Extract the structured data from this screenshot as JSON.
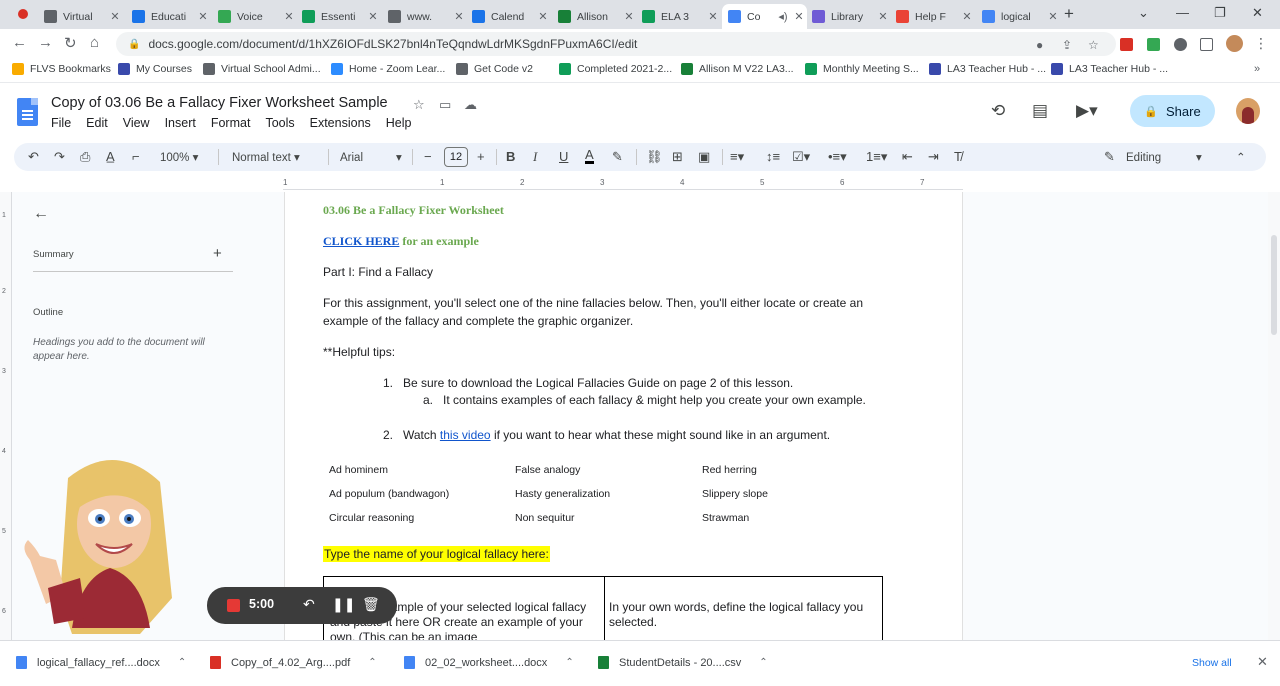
{
  "browser": {
    "tabs": [
      {
        "label": "Virtual",
        "color": "#5f6368",
        "active": false
      },
      {
        "label": "Educati",
        "color": "#1a73e8",
        "active": false
      },
      {
        "label": "Voice",
        "color": "#34a853",
        "active": false
      },
      {
        "label": "Essenti",
        "color": "#0f9d58",
        "active": false
      },
      {
        "label": "www.",
        "color": "#5f6368",
        "active": false
      },
      {
        "label": "Calend",
        "color": "#1a73e8",
        "active": false
      },
      {
        "label": "Allison",
        "color": "#188038",
        "active": false
      },
      {
        "label": "ELA 3",
        "color": "#0f9d58",
        "active": false
      },
      {
        "label": "Co",
        "color": "#4285f4",
        "active": true
      },
      {
        "label": "Library",
        "color": "#6f5bd5",
        "active": false
      },
      {
        "label": "Help F",
        "color": "#ea4335",
        "active": false
      },
      {
        "label": "logical",
        "color": "#4285f4",
        "active": false
      }
    ],
    "url": "docs.google.com/document/d/1hXZ6IOFdLSK27bnl4nTeQqndwLdrMKSgdnFPuxmA6CI/edit",
    "bookmarks": [
      {
        "label": "FLVS Bookmarks",
        "color": "#f9ab00"
      },
      {
        "label": "My Courses",
        "color": "#3949ab"
      },
      {
        "label": "Virtual School Admi...",
        "color": "#5f6368"
      },
      {
        "label": "Home - Zoom Lear...",
        "color": "#2d8cff"
      },
      {
        "label": "Get Code v2",
        "color": "#5f6368"
      },
      {
        "label": "Completed 2021-2...",
        "color": "#0f9d58"
      },
      {
        "label": "Allison M V22 LA3...",
        "color": "#188038"
      },
      {
        "label": "Monthly Meeting S...",
        "color": "#0f9d58"
      },
      {
        "label": "LA3 Teacher Hub - ...",
        "color": "#3949ab"
      },
      {
        "label": "LA3 Teacher Hub - ...",
        "color": "#3949ab"
      }
    ]
  },
  "docs": {
    "title": "Copy of 03.06 Be a Fallacy Fixer Worksheet Sample",
    "menu": [
      "File",
      "Edit",
      "View",
      "Insert",
      "Format",
      "Tools",
      "Extensions",
      "Help"
    ],
    "share_label": "Share",
    "toolbar": {
      "zoom": "100%",
      "style": "Normal text",
      "font": "Arial",
      "font_size": "12",
      "mode": "Editing"
    },
    "ruler_numbers": [
      "1",
      "1",
      "2",
      "3",
      "4",
      "5",
      "6",
      "7"
    ]
  },
  "outline": {
    "summary_label": "Summary",
    "outline_label": "Outline",
    "hint": "Headings you add to the document will appear here."
  },
  "document": {
    "heading": "03.06 Be a Fallacy Fixer Worksheet",
    "click_here": "CLICK HERE",
    "click_suffix": " for an example",
    "part1": "Part I: Find a Fallacy",
    "intro": "For this assignment, you'll select one of the nine fallacies below. Then, you'll either locate or create an example of the fallacy and complete the graphic organizer.",
    "tips_heading": "**Helpful tips:",
    "tip1_num": "1.",
    "tip1": "Be sure to download the Logical Fallacies Guide on page 2 of this lesson.",
    "tip1a_num": "a.",
    "tip1a": "It contains examples of each fallacy & might help you create your own example.",
    "tip2_num": "2.",
    "tip2_pre": "Watch ",
    "tip2_link": "this video",
    "tip2_post": " if you want to hear what these might sound like in an argument.",
    "fallacies": [
      [
        "Ad hominem",
        "False analogy",
        "Red herring"
      ],
      [
        "Ad populum (bandwagon)",
        "Hasty generalization",
        "Slippery slope"
      ],
      [
        "Circular reasoning",
        "Non sequitur",
        "Strawman"
      ]
    ],
    "type_prompt": "Type the name of your logical fallacy here:",
    "organizer_left": "Copy an example of your selected logical fallacy and paste it here OR create an example of your own. (This can be an image",
    "organizer_right": "In your own words, define the logical fallacy you selected."
  },
  "recorder": {
    "time": "5:00"
  },
  "downloads": [
    {
      "name": "logical_fallacy_ref....docx",
      "color": "#4285f4"
    },
    {
      "name": "Copy_of_4.02_Arg....pdf",
      "color": "#d93025"
    },
    {
      "name": "02_02_worksheet....docx",
      "color": "#4285f4"
    },
    {
      "name": "StudentDetails - 20....csv",
      "color": "#188038"
    }
  ],
  "downloads_show_all": "Show all"
}
